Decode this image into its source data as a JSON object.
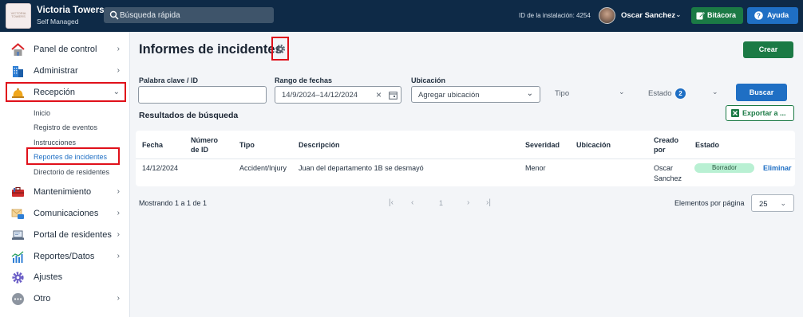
{
  "header": {
    "logo_text": "VICTORIA TOWERS",
    "app_title": "Victoria Towers",
    "app_subtitle": "Self Managed",
    "search_placeholder": "Búsqueda rápida",
    "install_id": "ID de la instalación: 4254",
    "user_name": "Oscar Sanchez",
    "user_chevron": "⌄",
    "bitacora_label": "Bitácora",
    "ayuda_label": "Ayuda"
  },
  "sidebar": {
    "items": [
      {
        "label": "Panel de control",
        "icon": "house-icon",
        "chevron": "›"
      },
      {
        "label": "Administrar",
        "icon": "building-icon",
        "chevron": "›"
      },
      {
        "label": "Recepción",
        "icon": "bell-icon",
        "chevron": "⌄"
      },
      {
        "label": "Mantenimiento",
        "icon": "toolbox-icon",
        "chevron": "›"
      },
      {
        "label": "Comunicaciones",
        "icon": "mail-icon",
        "chevron": "›"
      },
      {
        "label": "Portal de residentes",
        "icon": "laptop-icon",
        "chevron": "›"
      },
      {
        "label": "Reportes/Datos",
        "icon": "chart-icon",
        "chevron": "›"
      },
      {
        "label": "Ajustes",
        "icon": "gear-icon",
        "chevron": ""
      },
      {
        "label": "Otro",
        "icon": "dots-icon",
        "chevron": "›"
      }
    ],
    "recepcion_sub": [
      "Inicio",
      "Registro de eventos",
      "Instrucciones",
      "Reportes de incidentes",
      "Directorio de residentes"
    ]
  },
  "main": {
    "title": "Informes de incidentes",
    "create_label": "Crear",
    "filters": {
      "keyword_label": "Palabra clave / ID",
      "keyword_value": "",
      "date_label": "Rango de fechas",
      "date_value": "14/9/2024–14/12/2024",
      "location_label": "Ubicación",
      "location_value": "Agregar ubicación",
      "type_label": "Tipo",
      "status_label": "Estado",
      "status_count": "2",
      "search_label": "Buscar"
    },
    "export_label": "Exportar a ...",
    "results_title": "Resultados de búsqueda",
    "table": {
      "headers": [
        "Fecha",
        "Número de ID",
        "Tipo",
        "Descripción",
        "Severidad",
        "Ubicación",
        "Creado por",
        "Estado"
      ],
      "rows": [
        {
          "fecha": "14/12/2024",
          "id": "",
          "tipo": "Accident/Injury",
          "descripcion": "Juan del departamento 1B se desmayó",
          "severidad": "Menor",
          "ubicacion": "",
          "creado_por": "Oscar Sanchez",
          "estado": "Borrador",
          "action": "Eliminar"
        }
      ]
    },
    "pagination": {
      "showing": "Mostrando 1 a 1 de 1",
      "current_page": "1",
      "per_page_label": "Elementos por página",
      "per_page_value": "25"
    }
  },
  "colors": {
    "topbar": "#0e2a47",
    "green": "#1b7a45",
    "blue": "#1f6fc4",
    "highlight": "#e0101a"
  }
}
